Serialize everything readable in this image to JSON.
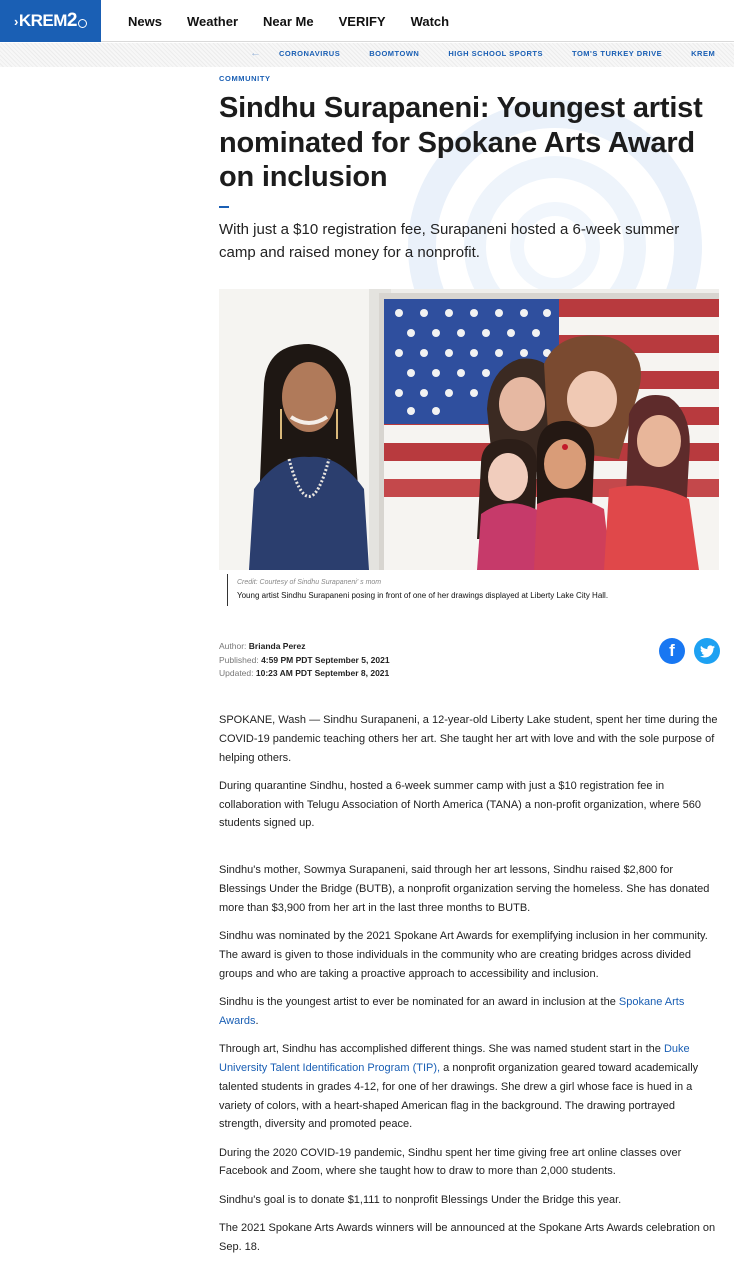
{
  "header": {
    "logo": {
      "text": "KREM",
      "number": "2"
    },
    "nav": [
      "News",
      "Weather",
      "Near Me",
      "VERIFY",
      "Watch"
    ],
    "subnav": [
      "CORONAVIRUS",
      "BOOMTOWN",
      "HIGH SCHOOL SPORTS",
      "TOM'S TURKEY DRIVE",
      "KREM"
    ]
  },
  "article": {
    "kicker": "COMMUNITY",
    "title": "Sindhu Surapaneni: Youngest artist nominated for Spokane Arts Award on inclusion",
    "summary": "With just a $10 registration fee, Surapaneni hosted a 6-week summer camp and raised money for a nonprofit.",
    "image": {
      "credit": "Credit: Courtesy of Sindhu Surapaneni' s mom",
      "caption": "Young artist Sindhu Surapaneni posing in front of one of her drawings displayed at Liberty Lake City Hall."
    },
    "byline": {
      "author_label": "Author:",
      "author": "Brianda Perez",
      "published_label": "Published:",
      "published": "4:59 PM PDT September 5, 2021",
      "updated_label": "Updated:",
      "updated": "10:23 AM PDT September 8, 2021"
    },
    "paragraphs": {
      "p1": "SPOKANE, Wash — Sindhu Surapaneni, a 12-year-old Liberty Lake student, spent her time during the COVID-19 pandemic teaching others her art. She taught her art with love and with the sole purpose of helping others.",
      "p2": "During quarantine Sindhu, hosted a 6-week summer camp with just a $10 registration fee in collaboration with Telugu Association of North America (TANA) a non-profit organization, where 560 students signed up.",
      "p3": "Sindhu's mother, Sowmya Surapaneni, said through her art lessons, Sindhu raised $2,800 for Blessings Under the Bridge (BUTB), a nonprofit organization serving the homeless. She has donated more than $3,900 from her art in the last three months to BUTB.",
      "p4": "Sindhu was nominated by the 2021 Spokane Art Awards for exemplifying inclusion in her community. The award is given to those individuals in the community who are creating bridges across divided groups and who are taking a proactive approach to accessibility and inclusion.",
      "p5_pre": "Sindhu is the youngest artist to ever be nominated for an award in inclusion at the ",
      "p5_link": "Spokane Arts Awards",
      "p5_post": ".",
      "p6_pre": "Through art, Sindhu has accomplished different things. She was named student start in the ",
      "p6_link": "Duke University Talent Identification Program (TIP),",
      "p6_post": " a nonprofit organization geared toward academically talented students in grades 4-12, for one of her drawings. She drew a girl whose face is hued  in a variety of colors, with a heart-shaped American flag in the background. The drawing portrayed strength, diversity and promoted peace.",
      "p7": "During the 2020 COVID-19 pandemic, Sindhu spent her time giving free art online classes over Facebook and Zoom, where she taught how to draw to more than 2,000 students.",
      "p8": "Sindhu's goal is to donate $1,111 to nonprofit Blessings Under the Bridge this year.",
      "p9": "The 2021 Spokane Arts Awards winners will be announced at the Spokane Arts Awards celebration on Sep. 18."
    }
  }
}
